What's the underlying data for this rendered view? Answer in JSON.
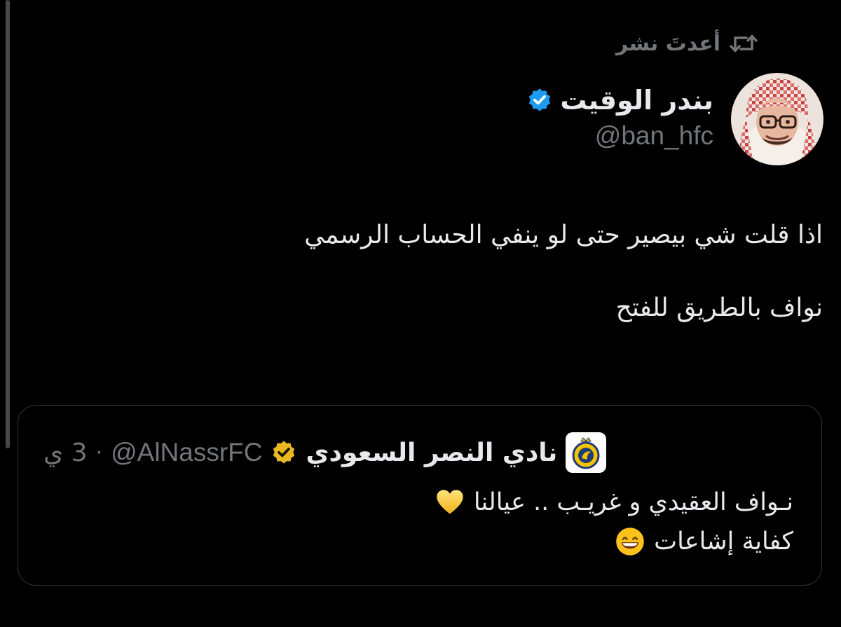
{
  "repost": {
    "label": "أعدتَ نشر",
    "icon": "repost-icon"
  },
  "author": {
    "name": "بندر الوقيت",
    "handle": "@ban_hfc",
    "verified_color": "#1d9bf0"
  },
  "tweet": {
    "lines": [
      "اذا قلت شي بيصير حتى لو ينفي الحساب الرسمي",
      "نواف بالطريق للفتح"
    ]
  },
  "quote": {
    "name": "نادي النصر السعودي",
    "handle": "@AlNassrFC",
    "separator": "·",
    "time": "3 ي",
    "verified_color": "#e8b923",
    "line1": "نـواف العقيدي و غريـب .. عيالنا",
    "line1_emoji": "yellow-heart-icon",
    "line2": "كفاية إشاعات",
    "line2_emoji": "grinning-face-icon"
  },
  "colors": {
    "background": "#000000",
    "text": "#e7e9ea",
    "secondary": "#71767b",
    "border": "#2f3336"
  }
}
